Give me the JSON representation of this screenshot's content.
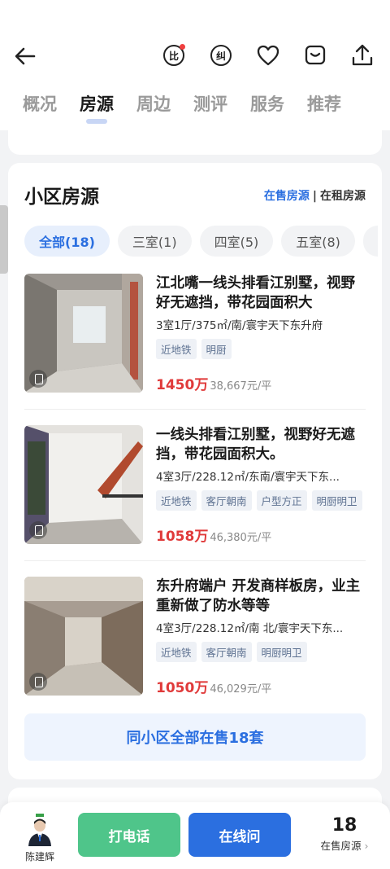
{
  "header": {
    "tabs": [
      {
        "label": "概况"
      },
      {
        "label": "房源"
      },
      {
        "label": "周边"
      },
      {
        "label": "测评"
      },
      {
        "label": "服务"
      },
      {
        "label": "推荐"
      }
    ],
    "active_tab": "房源",
    "icons": {
      "compare": "比",
      "correct": "纠"
    }
  },
  "section": {
    "title": "小区房源",
    "switch_on": "在售房源",
    "switch_sep": "|",
    "switch_off": "在租房源"
  },
  "filters": [
    {
      "label": "全部(18)",
      "active": true
    },
    {
      "label": "三室(1)"
    },
    {
      "label": "四室(5)"
    },
    {
      "label": "五室(8)"
    }
  ],
  "listings": [
    {
      "title": "江北嘴一线头排看江别墅，视野好无遮挡，带花园面积大",
      "meta": "3室1厅/375㎡/南/寰宇天下东升府",
      "tags": [
        "近地铁",
        "明厨"
      ],
      "total_price": "1450万",
      "unit_price": "38,667元/平"
    },
    {
      "title": "一线头排看江别墅，视野好无遮挡，带花园面积大。",
      "meta": "4室3厅/228.12㎡/东南/寰宇天下东...",
      "tags": [
        "近地铁",
        "客厅朝南",
        "户型方正",
        "明厨明卫"
      ],
      "total_price": "1058万",
      "unit_price": "46,380元/平"
    },
    {
      "title": "东升府端户 开发商样板房，业主重新做了防水等等",
      "meta": "4室3厅/228.12㎡/南 北/寰宇天下东...",
      "tags": [
        "近地铁",
        "客厅朝南",
        "明厨明卫"
      ],
      "total_price": "1050万",
      "unit_price": "46,029元/平"
    }
  ],
  "all_button": "同小区全部在售18套",
  "bottom": {
    "agent_name": "陈建辉",
    "call": "打电话",
    "chat": "在线问",
    "onsale_count": "18",
    "onsale_label": "在售房源",
    "chevron": "›"
  },
  "colors": {
    "accent": "#2b6fe0",
    "price": "#e03a3a",
    "call": "#4fc58a"
  }
}
